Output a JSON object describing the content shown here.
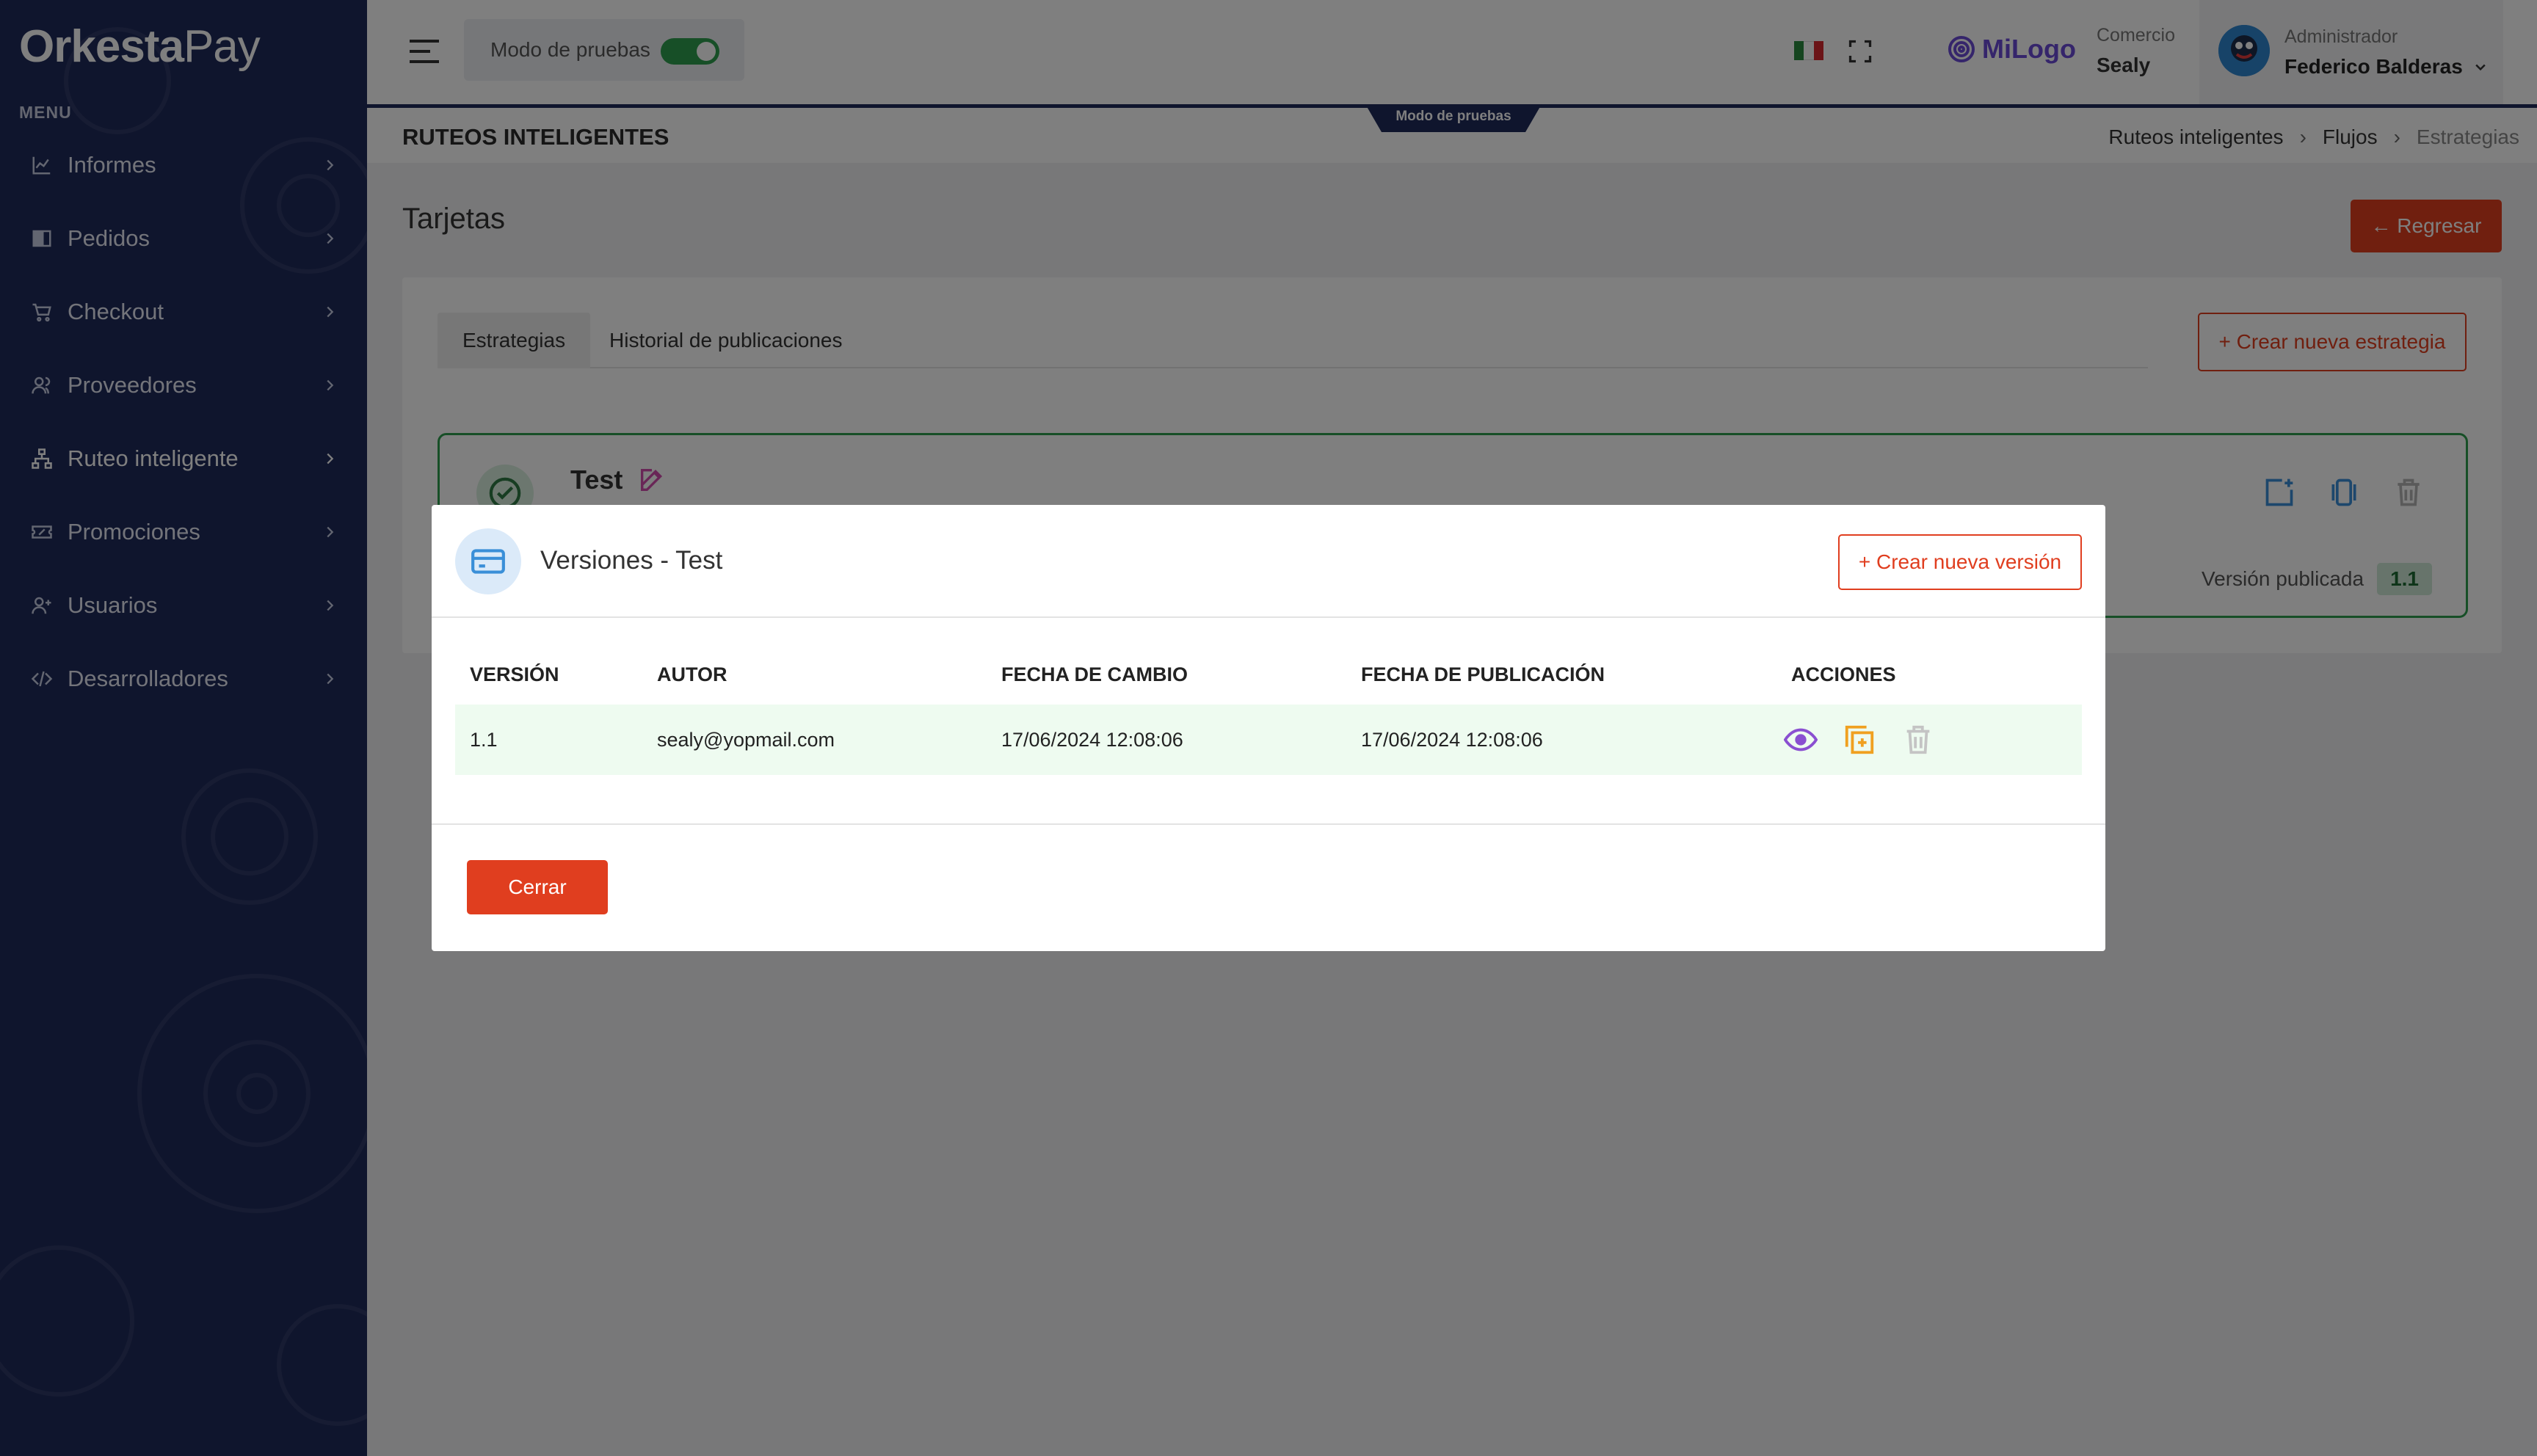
{
  "app": {
    "logo_prefix": "Orkesta",
    "logo_suffix": "Pay",
    "menu_label": "MENU"
  },
  "sidebar": {
    "items": [
      {
        "label": "Informes",
        "icon": "chart-line-icon"
      },
      {
        "label": "Pedidos",
        "icon": "book-icon"
      },
      {
        "label": "Checkout",
        "icon": "cart-icon"
      },
      {
        "label": "Proveedores",
        "icon": "users-icon"
      },
      {
        "label": "Ruteo inteligente",
        "icon": "sitemap-icon"
      },
      {
        "label": "Promociones",
        "icon": "ticket-icon"
      },
      {
        "label": "Usuarios",
        "icon": "user-plus-icon"
      },
      {
        "label": "Desarrolladores",
        "icon": "code-icon"
      }
    ]
  },
  "header": {
    "test_mode_label": "Modo de pruebas",
    "test_mode_on": true,
    "brand_logo": "MiLogo",
    "comercio_label": "Comercio",
    "comercio_value": "Sealy",
    "admin_label": "Administrador",
    "admin_name": "Federico Balderas"
  },
  "titlebar": {
    "title": "RUTEOS INTELIGENTES",
    "test_mode_tab": "Modo de pruebas",
    "breadcrumbs": [
      "Ruteos inteligentes",
      "Flujos",
      "Estrategias"
    ]
  },
  "page": {
    "title": "Tarjetas",
    "back_button": "Regresar",
    "tabs": [
      "Estrategias",
      "Historial de publicaciones"
    ],
    "create_strategy_button": "+ Crear nueva estrategia",
    "strategy": {
      "name": "Test",
      "published_label": "Versión publicada",
      "published_version": "1.1"
    }
  },
  "modal": {
    "title": "Versiones - Test",
    "create_version_button": "+ Crear nueva versión",
    "columns": [
      "VERSIÓN",
      "AUTOR",
      "FECHA DE CAMBIO",
      "FECHA DE PUBLICACIÓN",
      "ACCIONES"
    ],
    "rows": [
      {
        "version": "1.1",
        "author": "sealy@yopmail.com",
        "changed": "17/06/2024 12:08:06",
        "published": "17/06/2024 12:08:06"
      }
    ],
    "close_button": "Cerrar"
  },
  "colors": {
    "sidebar": "#1e2a5a",
    "accent": "#e03e1f",
    "success": "#2e9e4f",
    "brand": "#6b4bd6"
  }
}
